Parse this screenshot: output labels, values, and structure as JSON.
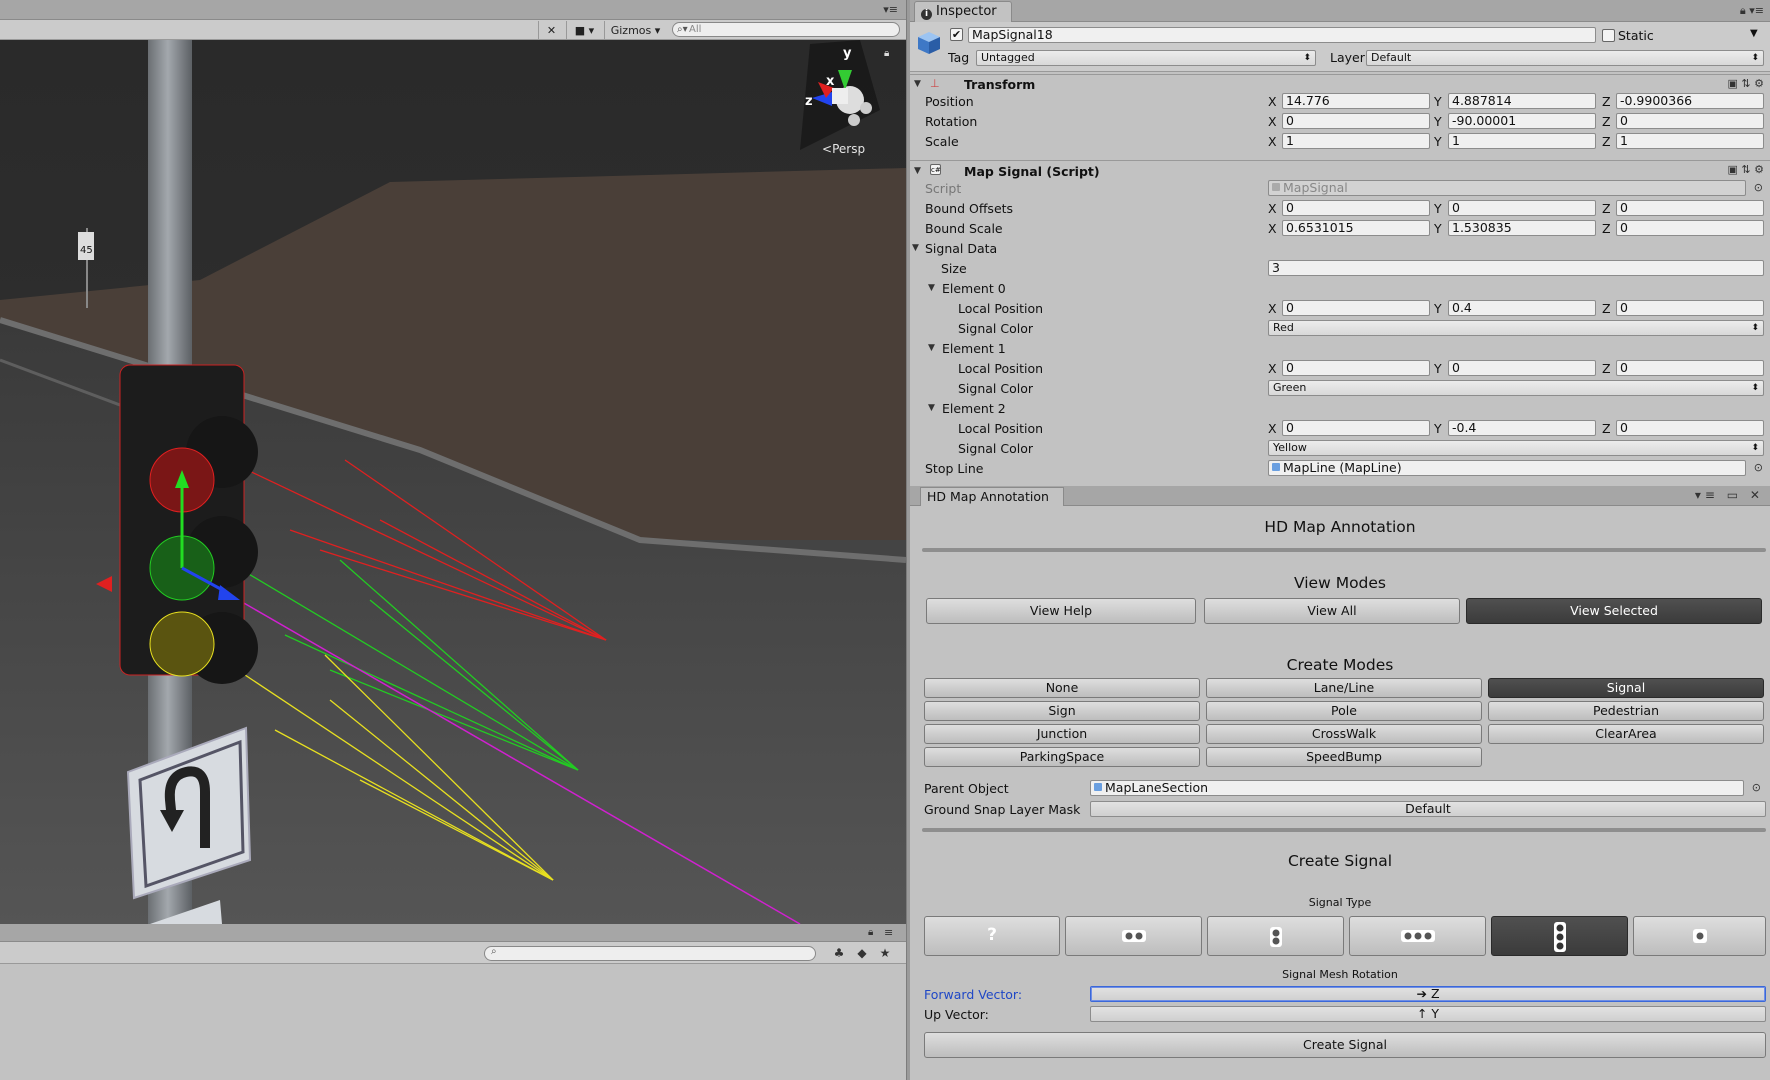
{
  "scene": {
    "toolbar": {
      "gizmos_label": "Gizmos",
      "search_placeholder": "All"
    },
    "gizmo": {
      "y_label": "y",
      "x_label": "x",
      "z_label": "z",
      "persp_label": "Persp"
    },
    "speed_sign": "45"
  },
  "inspector": {
    "tab_label": "Inspector",
    "object": {
      "name": "MapSignal18",
      "active": true,
      "static_label": "Static",
      "tag_label": "Tag",
      "tag_value": "Untagged",
      "layer_label": "Layer",
      "layer_value": "Default"
    },
    "transform": {
      "title": "Transform",
      "position_label": "Position",
      "rotation_label": "Rotation",
      "scale_label": "Scale",
      "position": {
        "x": "14.776",
        "y": "4.887814",
        "z": "-0.9900366"
      },
      "rotation": {
        "x": "0",
        "y": "-90.00001",
        "z": "0"
      },
      "scale": {
        "x": "1",
        "y": "1",
        "z": "1"
      }
    },
    "map_signal": {
      "title": "Map Signal (Script)",
      "script_label": "Script",
      "script_value": "MapSignal",
      "bound_offsets_label": "Bound Offsets",
      "bound_offsets": {
        "x": "0",
        "y": "0",
        "z": "0"
      },
      "bound_scale_label": "Bound Scale",
      "bound_scale": {
        "x": "0.6531015",
        "y": "1.530835",
        "z": "0"
      },
      "signal_data_label": "Signal Data",
      "size_label": "Size",
      "size_value": "3",
      "elements": [
        {
          "label": "Element 0",
          "local_position_label": "Local Position",
          "pos": {
            "x": "0",
            "y": "0.4",
            "z": "0"
          },
          "signal_color_label": "Signal Color",
          "color": "Red"
        },
        {
          "label": "Element 1",
          "local_position_label": "Local Position",
          "pos": {
            "x": "0",
            "y": "0",
            "z": "0"
          },
          "signal_color_label": "Signal Color",
          "color": "Green"
        },
        {
          "label": "Element 2",
          "local_position_label": "Local Position",
          "pos": {
            "x": "0",
            "y": "-0.4",
            "z": "0"
          },
          "signal_color_label": "Signal Color",
          "color": "Yellow"
        }
      ],
      "stop_line_label": "Stop Line",
      "stop_line_value": "MapLine (MapLine)"
    },
    "axis": {
      "x": "X",
      "y": "Y",
      "z": "Z"
    }
  },
  "hdmap": {
    "tab_label": "HD Map Annotation",
    "title": "HD Map Annotation",
    "view_modes_title": "View Modes",
    "view_buttons": [
      "View Help",
      "View All",
      "View Selected"
    ],
    "view_selected_index": 2,
    "create_modes_title": "Create Modes",
    "create_buttons": [
      "None",
      "Lane/Line",
      "Signal",
      "Sign",
      "Pole",
      "Pedestrian",
      "Junction",
      "CrossWalk",
      "ClearArea",
      "ParkingSpace",
      "SpeedBump"
    ],
    "create_selected": "Signal",
    "parent_object_label": "Parent Object",
    "parent_object_value": "MapLaneSection",
    "ground_snap_label": "Ground Snap Layer Mask",
    "ground_snap_value": "Default",
    "create_signal_title": "Create Signal",
    "signal_type_label": "Signal Type",
    "signal_types": [
      "unknown-type-icon",
      "horizontal-2-lights-icon",
      "vertical-2-lights-icon",
      "horizontal-3-lights-icon",
      "vertical-3-lights-icon",
      "single-light-icon"
    ],
    "signal_type_selected_index": 4,
    "signal_mesh_rotation_label": "Signal Mesh Rotation",
    "forward_vector_label": "Forward Vector:",
    "forward_vector_value": "Z",
    "up_vector_label": "Up Vector:",
    "up_vector_value": "Y",
    "create_signal_button": "Create Signal"
  },
  "colors": {
    "panel_bg": "#c2c2c2",
    "active_button": "#444444",
    "focus_blue": "#3b68d8",
    "signal_red": "#e02020",
    "signal_green": "#22cc22",
    "signal_yellow": "#e8e020",
    "ray_magenta": "#d020d0"
  }
}
